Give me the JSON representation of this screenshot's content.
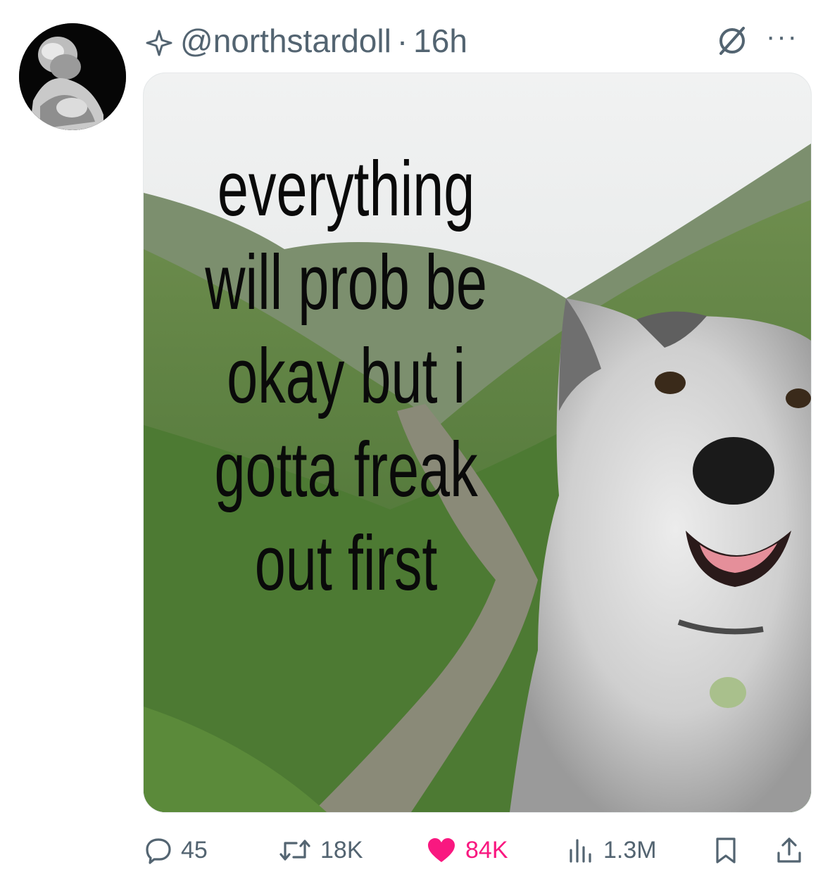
{
  "post": {
    "handle": "@northstardoll",
    "separator": "·",
    "time": "16h",
    "more_label": "···"
  },
  "media": {
    "meme_lines": [
      "everything",
      "will prob be",
      "okay but i",
      "gotta freak",
      "out first"
    ]
  },
  "actions": {
    "replies": "45",
    "reposts": "18K",
    "likes": "84K",
    "views": "1.3M"
  },
  "colors": {
    "secondary_text": "#536471",
    "like_active": "#f91880"
  },
  "icons": {
    "header": [
      "sparkle-icon",
      "no-sign-icon",
      "more-icon"
    ],
    "actions": [
      "reply-icon",
      "repost-icon",
      "heart-icon",
      "views-icon",
      "bookmark-icon",
      "share-icon"
    ]
  }
}
